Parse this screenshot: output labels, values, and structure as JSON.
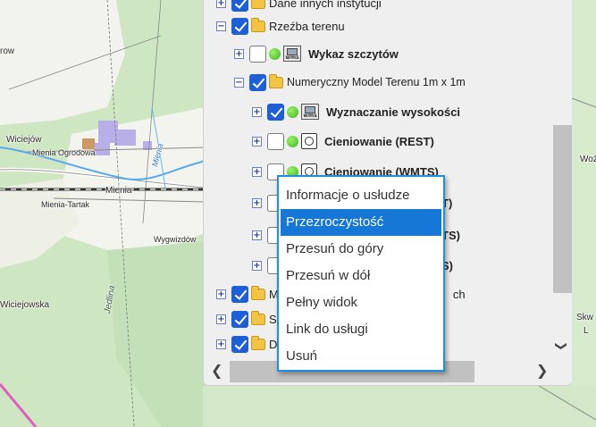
{
  "map": {
    "labels": {
      "row": "row",
      "wiciejow": "Wiciejów",
      "mienia_ogrodowa": "Mienia Ogrodowa",
      "mienia": "Mienia",
      "mienia_tartak": "Mienia-Tartak",
      "wygwizdow": "Wygwizdów",
      "wiciejowska": "Wiciejowska",
      "jedlina": "Jedlina",
      "mienia_river": "Mienia",
      "woz": "Woź",
      "skw": "Skw",
      "l": "L"
    }
  },
  "tree": {
    "rows": [
      {
        "label": "Dane innych instytucji",
        "expander": "+",
        "checked": true,
        "icon": "folder-icon",
        "bold": false
      },
      {
        "label": "Rzeźba terenu",
        "expander": "−",
        "checked": true,
        "icon": "folder-icon",
        "bold": false
      },
      {
        "label": "Wykaz szczytów",
        "expander": "+",
        "checked": false,
        "icon": "wms-icon",
        "bold": true
      },
      {
        "label": "Numeryczny Model Terenu 1m x 1m",
        "expander": "−",
        "checked": true,
        "icon": "folder-icon",
        "bold": false
      },
      {
        "label": "Wyznaczanie wysokości",
        "expander": "+",
        "checked": true,
        "icon": "wms-icon",
        "bold": true
      },
      {
        "label": "Cieniowanie (REST)",
        "expander": "+",
        "checked": false,
        "icon": "rest-icon",
        "bold": true
      },
      {
        "label": "Cieniowanie (WMTS)",
        "expander": "+",
        "checked": false,
        "icon": "rest-icon",
        "bold": true
      },
      {
        "label": "T)",
        "expander": "+",
        "checked": false,
        "icon": "",
        "bold": true
      },
      {
        "label": "TS)",
        "expander": "+",
        "checked": false,
        "icon": "",
        "bold": true
      },
      {
        "label": "S)",
        "expander": "+",
        "checked": false,
        "icon": "",
        "bold": true
      },
      {
        "label": "M",
        "label_tail": "ch",
        "expander": "+",
        "checked": true,
        "icon": "folder-icon",
        "bold": false
      },
      {
        "label": "S",
        "expander": "+",
        "checked": true,
        "icon": "folder-icon",
        "bold": false
      },
      {
        "label": "D",
        "expander": "+",
        "checked": true,
        "icon": "folder-icon",
        "bold": false
      }
    ]
  },
  "context_menu": {
    "items": [
      {
        "label": "Informacje o usłudze",
        "selected": false
      },
      {
        "label": "Przezroczystość",
        "selected": true
      },
      {
        "label": "Przesuń do góry",
        "selected": false
      },
      {
        "label": "Przesuń w dół",
        "selected": false
      },
      {
        "label": "Pełny widok",
        "selected": false
      },
      {
        "label": "Link do usługi",
        "selected": false
      },
      {
        "label": "Usuń",
        "selected": false
      }
    ]
  },
  "scrollbars": {
    "left_arrow": "❮",
    "right_arrow": "❯",
    "down_arrow": "❯"
  },
  "icons": {
    "wms_text": "wms",
    "rest_text": "C"
  },
  "colors": {
    "accent": "#1777d6",
    "checkbox_on": "#1d5fd6",
    "menu_border": "#1e90e0"
  }
}
